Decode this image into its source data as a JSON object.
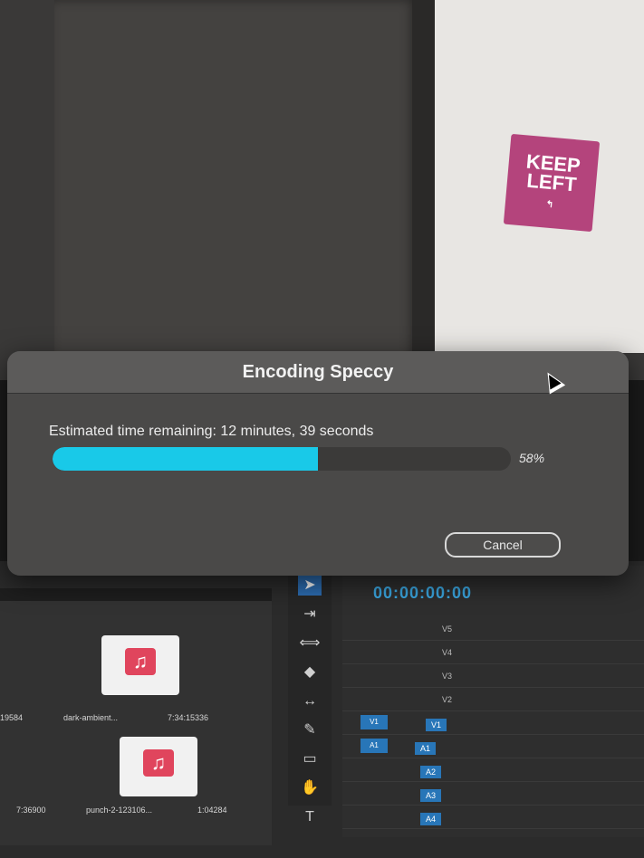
{
  "dialog": {
    "title": "Encoding Speccy",
    "estimate_text": "Estimated time remaining: 12 minutes, 39 seconds",
    "progress_fraction": 0.58,
    "progress_percent_label": "58%",
    "cancel_label": "Cancel"
  },
  "sticker": {
    "line1": "KEEP",
    "line2": "LEFT"
  },
  "project_panel": {
    "clips": [
      {
        "name": "dark-ambient...",
        "duration": "7:34:15336"
      },
      {
        "name": "punch-2-123106...",
        "duration": "1:04284"
      }
    ],
    "left_values": [
      "19584",
      "7:36900"
    ]
  },
  "timeline": {
    "timecode": "00:00:00:00",
    "video_tracks": [
      "V5",
      "V4",
      "V3",
      "V2",
      "V1"
    ],
    "audio_tracks": [
      "A1",
      "A2",
      "A3",
      "A4"
    ]
  },
  "colors": {
    "progress": "#19c9e8",
    "timecode": "#3aa6e0",
    "sticker": "#b4447c"
  }
}
